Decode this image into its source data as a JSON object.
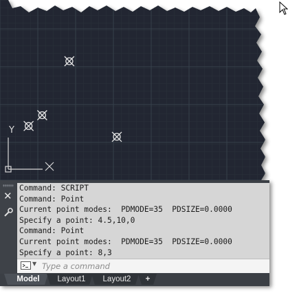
{
  "viewport": {
    "ucs_y_label": "Y",
    "point_markers": [
      {
        "name": "point-marker-1",
        "x": 4.5,
        "y": 10
      },
      {
        "name": "point-marker-2",
        "x": 2.5,
        "y": 5
      },
      {
        "name": "point-marker-3",
        "x": 1.5,
        "y": 4
      },
      {
        "name": "point-marker-4",
        "x": 8,
        "y": 3
      }
    ]
  },
  "command_history": [
    "Command: SCRIPT",
    "Command: Point",
    "Current point modes:  PDMODE=35  PDSIZE=0.0000",
    "Specify a point: 4.5,10,0",
    "Command: Point",
    "Current point modes:  PDMODE=35  PDSIZE=0.0000",
    "Specify a point: 8,3"
  ],
  "command_input": {
    "placeholder": "Type a command"
  },
  "tabs": [
    {
      "label": "Model",
      "active": true
    },
    {
      "label": "Layout1",
      "active": false
    },
    {
      "label": "Layout2",
      "active": false
    },
    {
      "label": "+",
      "active": false
    }
  ],
  "colors": {
    "drawing_background": "#212830",
    "grid_minor": "#2b323b",
    "grid_major": "#353e48",
    "point_marker": "#e6e6e6"
  }
}
